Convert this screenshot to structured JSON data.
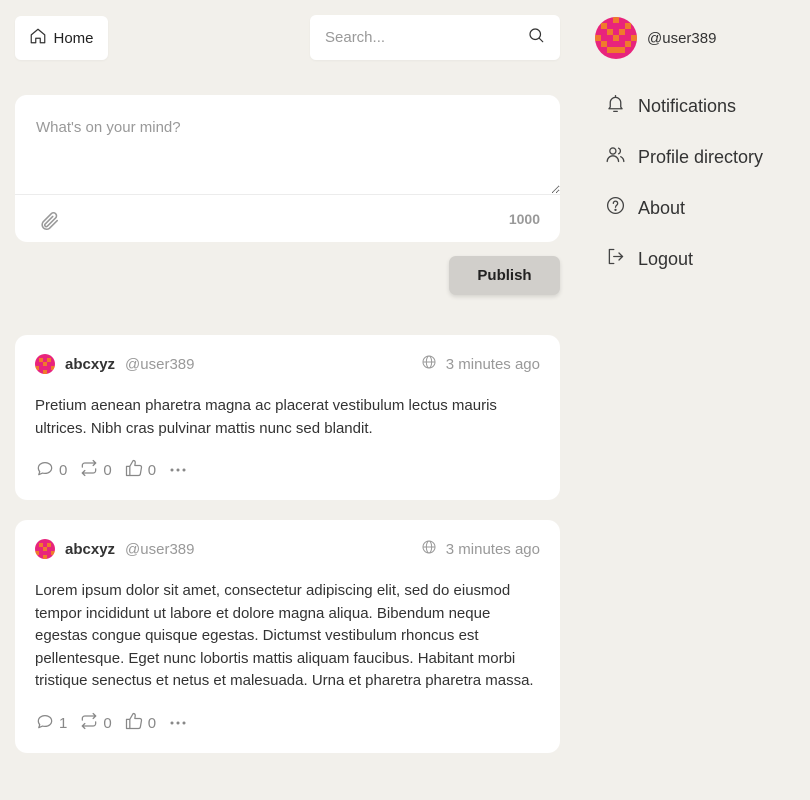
{
  "header": {
    "home_label": "Home",
    "home_icon": "home-icon",
    "search_placeholder": "Search...",
    "search_icon": "search-icon"
  },
  "composer": {
    "placeholder": "What's on your mind?",
    "value": "",
    "char_count": "1000",
    "attach_icon": "paperclip-icon",
    "publish_label": "Publish"
  },
  "profile": {
    "handle": "@user389",
    "avatar_colors": [
      "#e8247c",
      "#f07a2c"
    ]
  },
  "menu": [
    {
      "label": "Notifications",
      "icon": "bell-icon"
    },
    {
      "label": "Profile directory",
      "icon": "users-icon"
    },
    {
      "label": "About",
      "icon": "help-circle-icon"
    },
    {
      "label": "Logout",
      "icon": "logout-icon"
    }
  ],
  "posts": [
    {
      "author": "abcxyz",
      "handle": "@user389",
      "visibility_icon": "globe-icon",
      "time": "3 minutes ago",
      "body": "Pretium aenean pharetra magna ac placerat vestibulum lectus mauris ultrices. Nibh cras pulvinar mattis nunc sed blandit.",
      "replies": "0",
      "reposts": "0",
      "likes": "0"
    },
    {
      "author": "abcxyz",
      "handle": "@user389",
      "visibility_icon": "globe-icon",
      "time": "3 minutes ago",
      "body": "Lorem ipsum dolor sit amet, consectetur adipiscing elit, sed do eiusmod tempor incididunt ut labore et dolore magna aliqua. Bibendum neque egestas congue quisque egestas. Dictumst vestibulum rhoncus est pellentesque. Eget nunc lobortis mattis aliquam faucibus. Habitant morbi tristique senectus et netus et malesuada. Urna et pharetra pharetra massa.",
      "replies": "1",
      "reposts": "0",
      "likes": "0"
    }
  ],
  "colors": {
    "background": "#f2f0eb",
    "card": "#ffffff",
    "publish_button": "#d1cfcb",
    "muted_text": "#999999"
  }
}
